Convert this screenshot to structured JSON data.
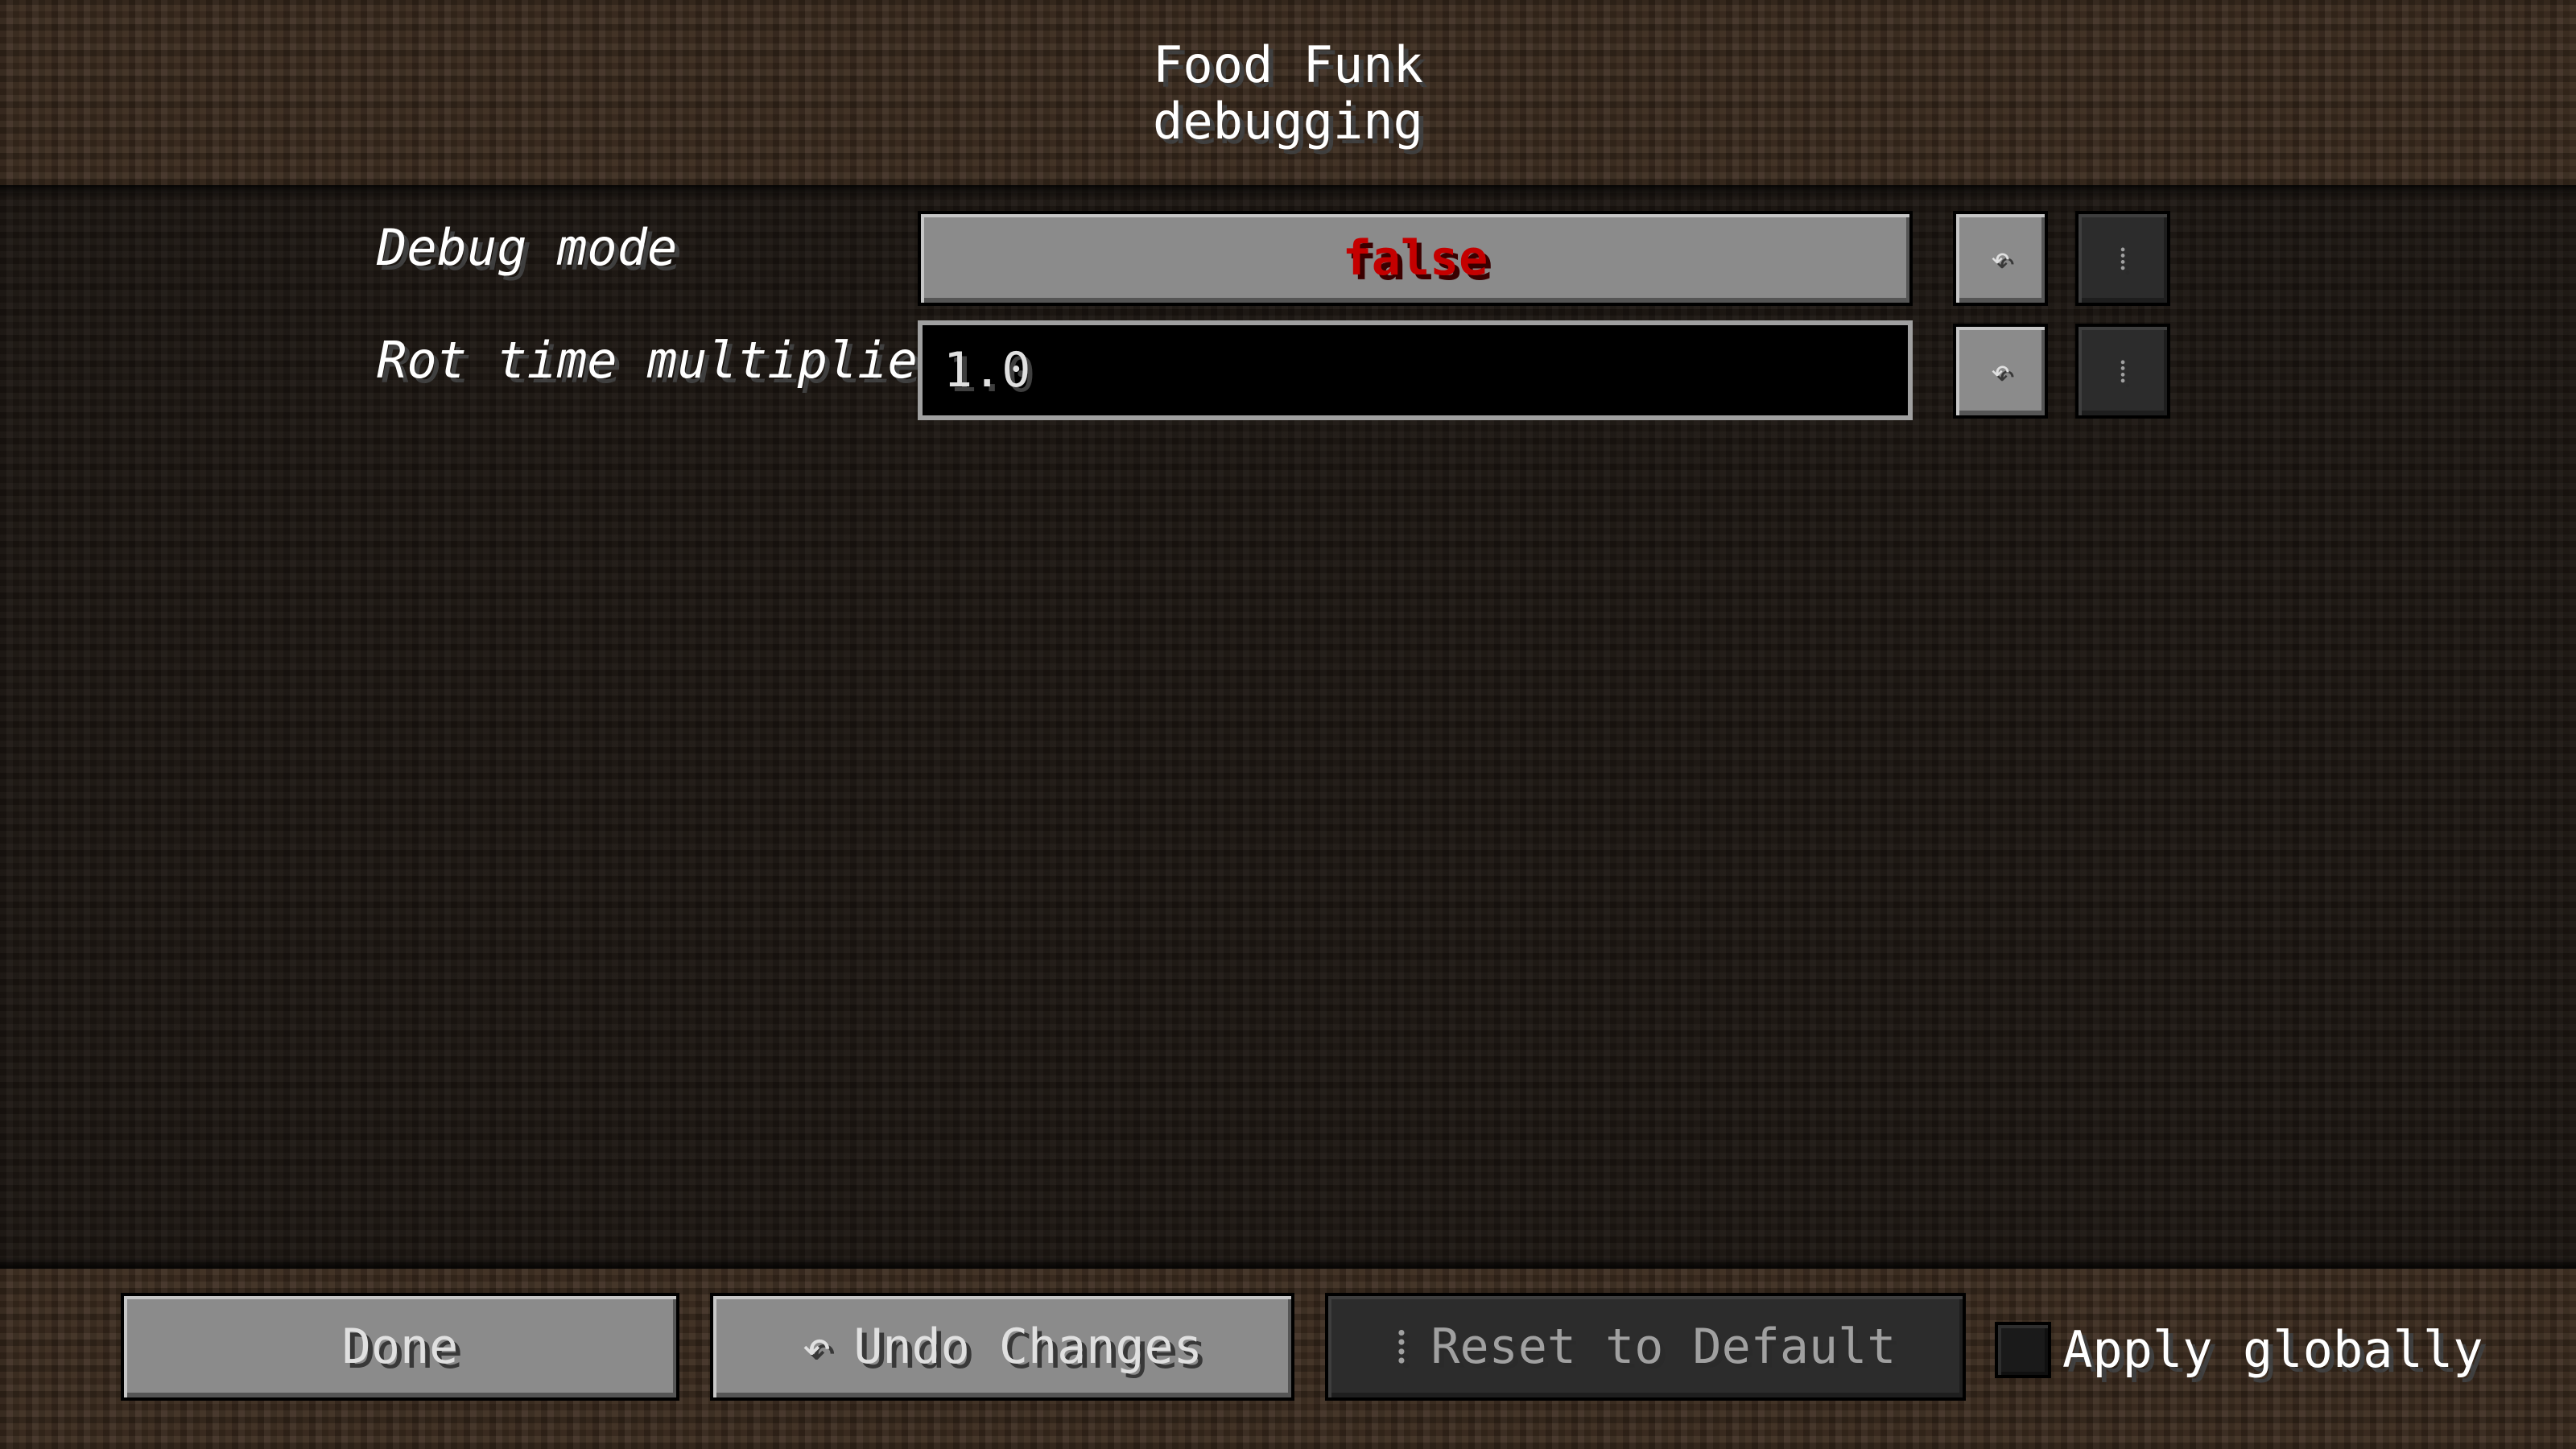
{
  "header": {
    "title_line_1": "Food Funk",
    "title_line_2": "debugging"
  },
  "options": [
    {
      "label": "Debug mode",
      "type": "toggle",
      "value": "false",
      "value_color": "#c40000",
      "undo_icon": "undo-arrow-icon",
      "undo_glyph": "↶",
      "reset_icon": "reset-icon",
      "reset_glyph": "⁞"
    },
    {
      "label": "Rot time multiplier",
      "type": "text",
      "value": "1.0",
      "undo_icon": "undo-arrow-icon",
      "undo_glyph": "↶",
      "reset_icon": "reset-icon",
      "reset_glyph": "⁞"
    }
  ],
  "footer": {
    "done_label": "Done",
    "undo_changes_label": "Undo Changes",
    "undo_changes_glyph": "↶",
    "reset_default_label": "Reset to Default",
    "reset_default_glyph": "⁞",
    "apply_globally_label": "Apply globally",
    "apply_globally_checked": false
  }
}
